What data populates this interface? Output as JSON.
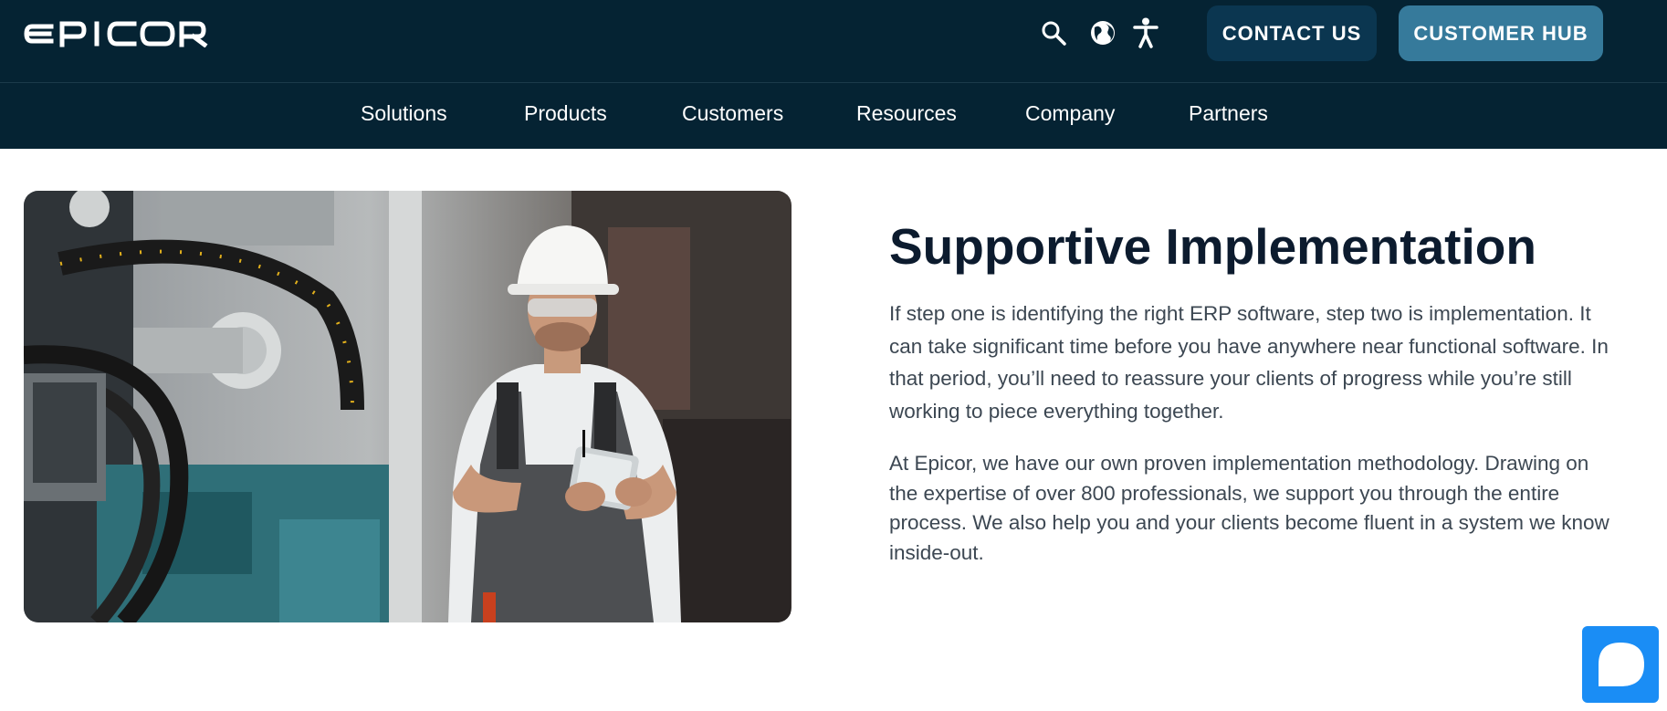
{
  "brand": {
    "logo_text": "EPICOR"
  },
  "header": {
    "icons": [
      "search-icon",
      "globe-icon",
      "accessibility-icon"
    ],
    "contact_label": "CONTACT US",
    "hub_label": "CUSTOMER HUB"
  },
  "nav": {
    "items": [
      {
        "label": "Solutions"
      },
      {
        "label": "Products"
      },
      {
        "label": "Customers"
      },
      {
        "label": "Resources"
      },
      {
        "label": "Company"
      },
      {
        "label": "Partners"
      }
    ]
  },
  "section": {
    "heading": "Supportive Implementation",
    "paragraph1": "If step one is identifying the right ERP software, step two is implementation. It can take significant time before you have anywhere near functional software. In that period, you’ll need to reassure your clients of progress while you’re still working to piece everything together.",
    "paragraph2": "At Epicor, we have our own proven implementation methodology. Drawing on the expertise of over 800 professionals, we support you through the entire process. We also help you and your clients become fluent in a system we know inside-out."
  },
  "colors": {
    "header_bg": "#052333",
    "contact_bg": "#0b3650",
    "hub_bg": "#367a9b",
    "heading": "#0c1b2e",
    "body_text": "#3c4752",
    "chat_bg": "#1a8df5"
  },
  "chat": {
    "icon": "chat-bubble-icon"
  }
}
